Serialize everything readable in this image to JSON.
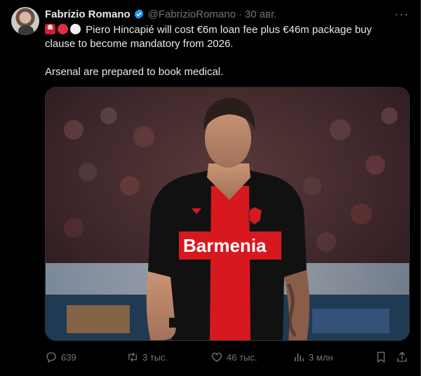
{
  "author": {
    "name": "Fabrizio Romano",
    "handle": "@FabrizioRomano",
    "separator": "·",
    "date": "30 авг."
  },
  "tweet": {
    "line1": "Piero Hincapié will cost €6m loan fee plus €46m package buy",
    "line2": "clause to become mandatory from 2026.",
    "line3": "Arsenal are prepared to book medical.",
    "emojis": [
      "siren-emoji",
      "red-circle-emoji",
      "white-circle-emoji"
    ]
  },
  "media": {
    "jersey_sponsor": "Barmenia"
  },
  "actions": {
    "replies": "639",
    "reposts": "3 тыс.",
    "likes": "46 тыс.",
    "views": "3 млн"
  },
  "colors": {
    "background": "#000000",
    "text": "#e7e9ea",
    "muted": "#71767b",
    "verified": "#1d9bf0",
    "jersey_red": "#d7191f"
  }
}
